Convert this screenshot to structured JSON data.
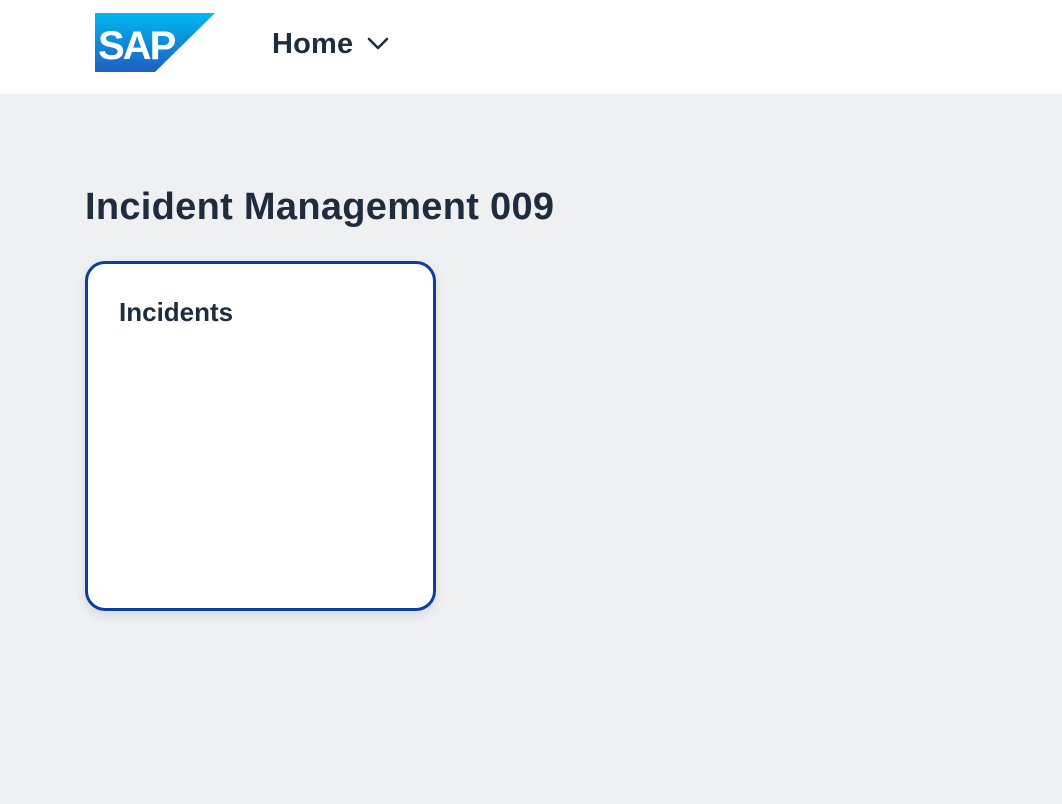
{
  "shellbar": {
    "logo_text": "SAP",
    "logo_icon": "sap-logo",
    "home_label": "Home",
    "home_chevron_icon": "chevron-down-icon"
  },
  "page": {
    "title": "Incident Management 009"
  },
  "tiles": [
    {
      "title": "Incidents"
    }
  ],
  "colors": {
    "background": "#eff0f2",
    "shellbar": "#ffffff",
    "text": "#1d2d3e",
    "tile_border_focus": "#0a3ea0",
    "logo_blue_top": "#00b8f1",
    "logo_blue_bottom": "#1e5fbf"
  }
}
